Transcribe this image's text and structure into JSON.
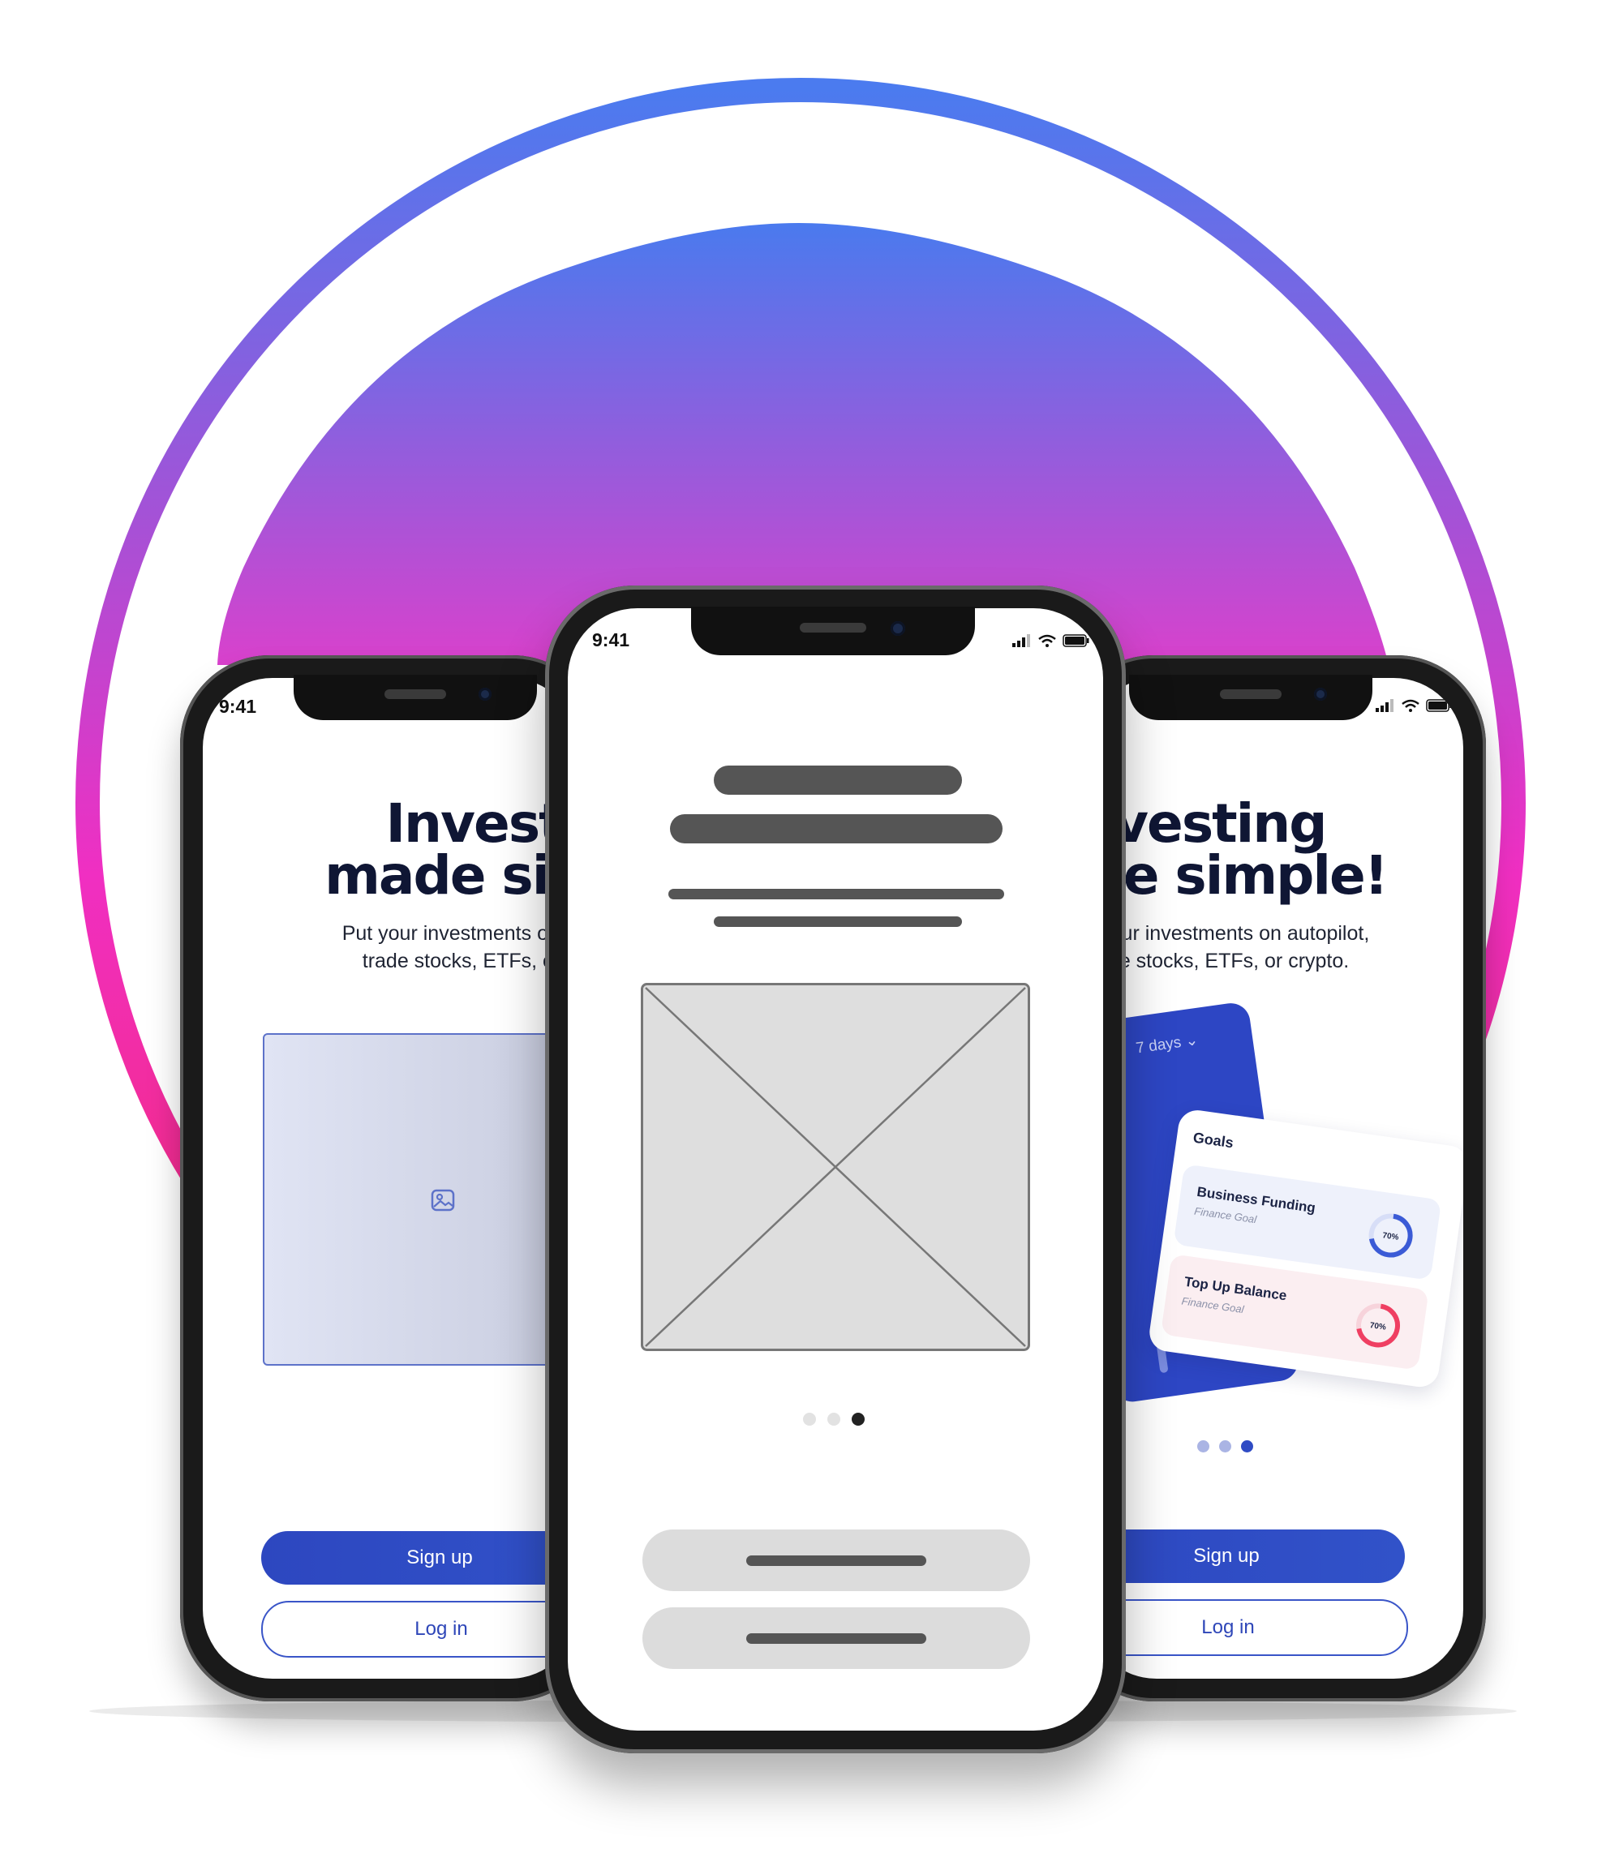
{
  "colors": {
    "ring_top": "#4b7bef",
    "ring_mid": "#f02fc2",
    "ring_bottom": "#f7285c",
    "dome_top": "#4a7aee",
    "dome_bottom": "#d43fd0",
    "primary": "#2f4bc4"
  },
  "left_phone": {
    "status_time": "9:41",
    "headline": "Investing\nmade simple!",
    "subtext": "Put your investments on autopilot,\ntrade stocks, ETFs, or crypto.",
    "image_placeholder_icon": "image-icon",
    "signup_label": "Sign up",
    "login_label": "Log in"
  },
  "center_phone": {
    "status_time": "9:41",
    "image_placeholder": "wireframe-image-x",
    "page_dots": {
      "count": 3,
      "active_index": 2
    }
  },
  "right_phone": {
    "headline": "Investing\nmade simple!",
    "subtext": "Put your investments on autopilot,\ntrade stocks, ETFs, or crypto.",
    "range_label": "7 days",
    "goals_title": "Goals",
    "goals": [
      {
        "title": "Business Funding",
        "subtitle": "Finance Goal",
        "percent_label": "70%",
        "percent": 70,
        "color": "#3b5bd6"
      },
      {
        "title": "Top Up Balance",
        "subtitle": "Finance Goal",
        "percent_label": "70%",
        "percent": 70,
        "color": "#ef3f62"
      }
    ],
    "page_dots": {
      "count": 3,
      "active_index": 2
    },
    "signup_label": "Sign up",
    "login_label": "Log in"
  }
}
